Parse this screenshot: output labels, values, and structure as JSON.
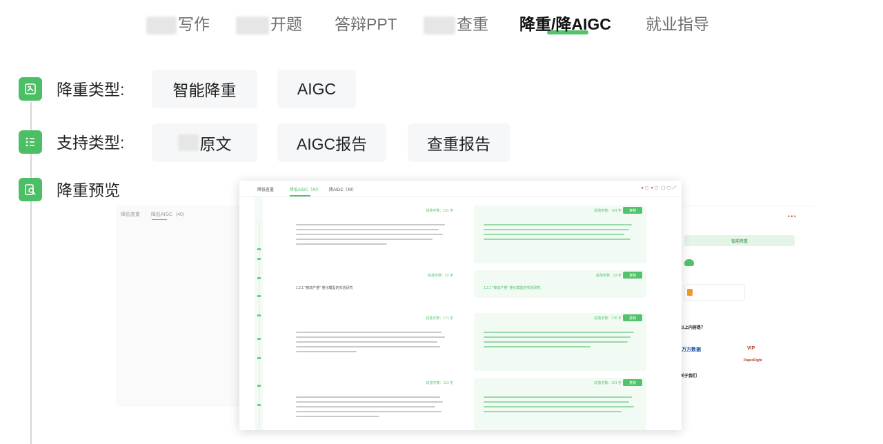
{
  "nav": {
    "items": [
      {
        "label": "写作",
        "blurred_prefix": true
      },
      {
        "label": "开题",
        "blurred_prefix": true
      },
      {
        "label": "答辩PPT",
        "blurred_prefix": false
      },
      {
        "label": "查重",
        "blurred_prefix": true
      },
      {
        "label": "降重/降AIGC",
        "blurred_prefix": false,
        "active": true
      },
      {
        "label": "就业指导",
        "blurred_prefix": false
      }
    ],
    "accent_color": "#52c26b"
  },
  "steps": [
    {
      "label": "降重类型:",
      "icon": "document-icon",
      "options": [
        "智能降重",
        "AIGC"
      ]
    },
    {
      "label": "支持类型:",
      "icon": "list-icon",
      "options": [
        "原文",
        "AIGC报告",
        "查重报告"
      ]
    },
    {
      "label": "降重预览",
      "icon": "preview-search-icon",
      "options": []
    }
  ],
  "preview": {
    "main_tabs": [
      "降低查重",
      "降低AIGC（40）",
      "降AIGC（40）"
    ],
    "toolbar_icons": [
      "bell-icon",
      "message-icon",
      "user-icon",
      "expand-icon"
    ],
    "cards": [
      {
        "side": "original",
        "meta": "段落字数：131 字"
      },
      {
        "side": "result",
        "meta": "段落字数：141 字",
        "button": "复制"
      },
      {
        "side": "original",
        "meta": "段落字数：22 字",
        "text": "1.2.1 \"被动产量\" 量化模型的实验研究"
      },
      {
        "side": "result",
        "meta": "段落字数：23 字",
        "button": "复制",
        "text": "1.2.1 \"被动产量\" 量化模型的实验研究"
      },
      {
        "side": "original",
        "meta": "段落字数：171 字"
      },
      {
        "side": "result",
        "meta": "段落字数：176 字",
        "button": "复制"
      },
      {
        "side": "original",
        "meta": "段落字数：113 字"
      },
      {
        "side": "result",
        "meta": "段落字数：121 字",
        "button": "复制"
      }
    ],
    "right_panel": {
      "green_bar": "智能降重",
      "section_1": "以上内容是？",
      "section_2": "关于我们",
      "logos": [
        "万方数据",
        "VIP",
        "PaperRight"
      ]
    }
  }
}
